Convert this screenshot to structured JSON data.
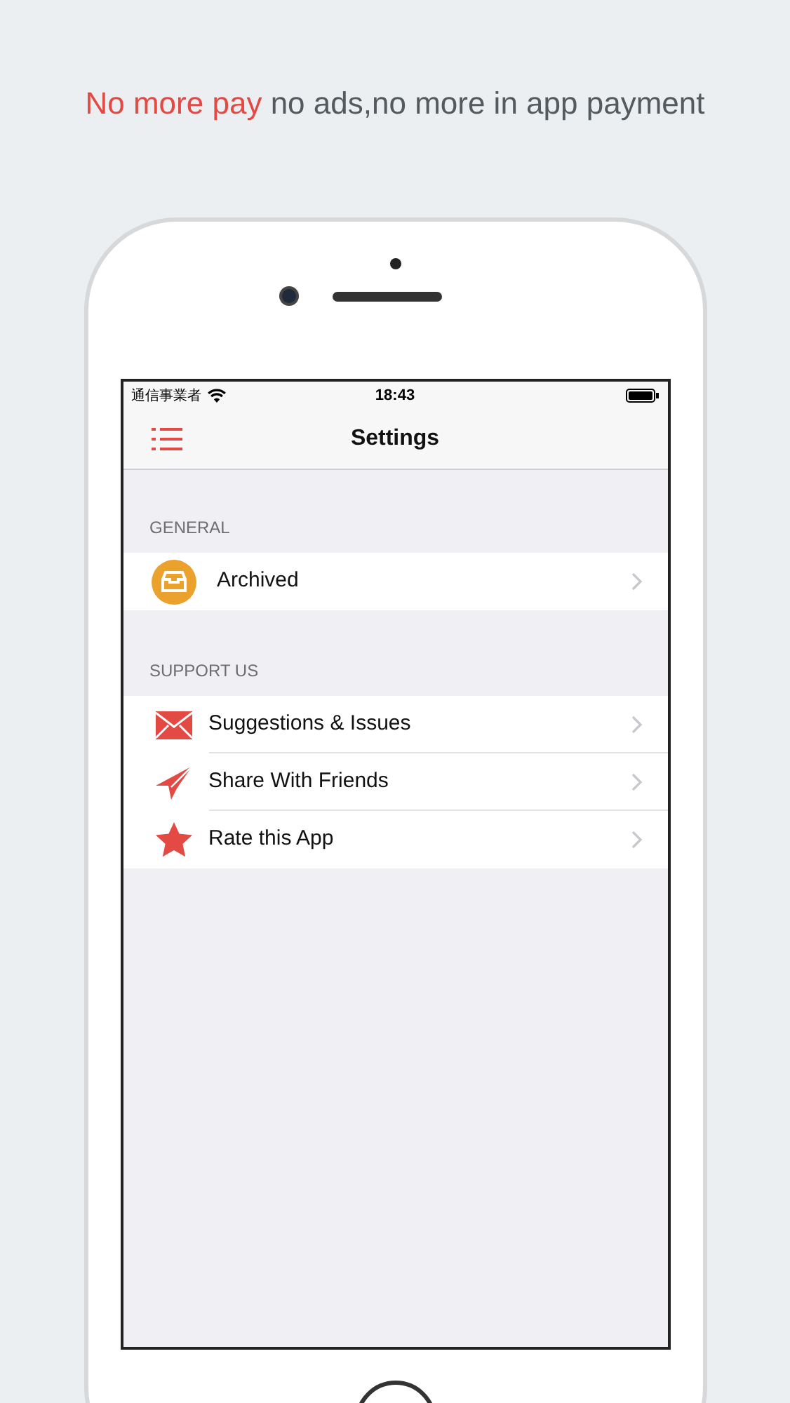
{
  "headline": {
    "highlight": "No more pay",
    "rest": "no ads,no more in app payment"
  },
  "status_bar": {
    "carrier": "通信事業者",
    "time": "18:43"
  },
  "nav": {
    "title": "Settings"
  },
  "sections": [
    {
      "header": "GENERAL",
      "rows": [
        {
          "kind": "archive",
          "label": "Archived"
        }
      ]
    },
    {
      "header": "SUPPORT US",
      "rows": [
        {
          "kind": "mail",
          "label": "Suggestions & Issues"
        },
        {
          "kind": "plane",
          "label": "Share With Friends"
        },
        {
          "kind": "star",
          "label": "Rate this App"
        }
      ]
    }
  ]
}
